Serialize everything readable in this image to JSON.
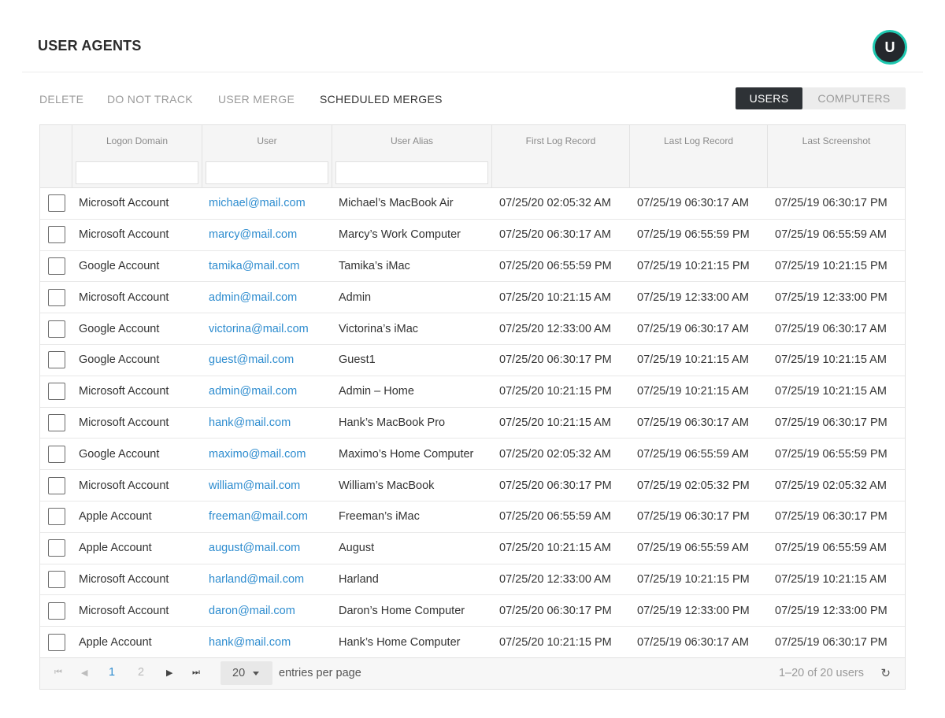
{
  "header": {
    "title": "USER AGENTS",
    "avatar_initial": "U"
  },
  "toolbar": {
    "actions": [
      "DELETE",
      "DO NOT TRACK",
      "USER MERGE",
      "SCHEDULED MERGES"
    ],
    "toggle": {
      "selected": "USERS",
      "other": "COMPUTERS"
    }
  },
  "columns": [
    "Logon Domain",
    "User",
    "User Alias",
    "First Log Record",
    "Last Log Record",
    "Last Screenshot"
  ],
  "filters": {
    "domain": "",
    "user": "",
    "alias": ""
  },
  "rows": [
    {
      "domain": "Microsoft Account",
      "user": "michael@mail.com",
      "alias": "Michael’s MacBook Air",
      "first": "07/25/20 02:05:32 AM",
      "last": "07/25/19 06:30:17 AM",
      "screenshot": "07/25/19 06:30:17 PM"
    },
    {
      "domain": "Microsoft Account",
      "user": "marcy@mail.com",
      "alias": "Marcy’s Work Computer",
      "first": "07/25/20 06:30:17 AM",
      "last": "07/25/19 06:55:59 PM",
      "screenshot": "07/25/19 06:55:59 AM"
    },
    {
      "domain": "Google Account",
      "user": "tamika@mail.com",
      "alias": "Tamika’s iMac",
      "first": "07/25/20 06:55:59 PM",
      "last": "07/25/19 10:21:15 PM",
      "screenshot": "07/25/19 10:21:15 PM"
    },
    {
      "domain": "Microsoft Account",
      "user": "admin@mail.com",
      "alias": "Admin",
      "first": "07/25/20 10:21:15 AM",
      "last": "07/25/19 12:33:00 AM",
      "screenshot": "07/25/19 12:33:00 PM"
    },
    {
      "domain": "Google Account",
      "user": "victorina@mail.com",
      "alias": "Victorina’s iMac",
      "first": "07/25/20 12:33:00 AM",
      "last": "07/25/19 06:30:17 AM",
      "screenshot": "07/25/19 06:30:17 AM"
    },
    {
      "domain": "Google Account",
      "user": "guest@mail.com",
      "alias": "Guest1",
      "first": "07/25/20 06:30:17 PM",
      "last": "07/25/19 10:21:15 AM",
      "screenshot": "07/25/19 10:21:15 AM"
    },
    {
      "domain": "Microsoft Account",
      "user": "admin@mail.com",
      "alias": "Admin – Home",
      "first": "07/25/20 10:21:15 PM",
      "last": "07/25/19 10:21:15 AM",
      "screenshot": "07/25/19 10:21:15 AM"
    },
    {
      "domain": "Microsoft Account",
      "user": "hank@mail.com",
      "alias": "Hank’s MacBook Pro",
      "first": "07/25/20 10:21:15 AM",
      "last": "07/25/19 06:30:17 AM",
      "screenshot": "07/25/19 06:30:17 PM"
    },
    {
      "domain": "Google Account",
      "user": "maximo@mail.com",
      "alias": "Maximo’s Home Computer",
      "first": "07/25/20 02:05:32 AM",
      "last": "07/25/19 06:55:59 AM",
      "screenshot": "07/25/19 06:55:59 PM"
    },
    {
      "domain": "Microsoft Account",
      "user": "william@mail.com",
      "alias": "William’s MacBook",
      "first": "07/25/20 06:30:17 PM",
      "last": "07/25/19 02:05:32 PM",
      "screenshot": "07/25/19 02:05:32 AM"
    },
    {
      "domain": "Apple Account",
      "user": "freeman@mail.com",
      "alias": "Freeman’s iMac",
      "first": "07/25/20 06:55:59 AM",
      "last": "07/25/19 06:30:17 PM",
      "screenshot": "07/25/19 06:30:17 PM"
    },
    {
      "domain": "Apple Account",
      "user": "august@mail.com",
      "alias": "August",
      "first": "07/25/20 10:21:15 AM",
      "last": "07/25/19 06:55:59 AM",
      "screenshot": "07/25/19 06:55:59 AM"
    },
    {
      "domain": "Microsoft Account",
      "user": "harland@mail.com",
      "alias": "Harland",
      "first": "07/25/20 12:33:00 AM",
      "last": "07/25/19 10:21:15 PM",
      "screenshot": "07/25/19 10:21:15 AM"
    },
    {
      "domain": "Microsoft Account",
      "user": "daron@mail.com",
      "alias": "Daron’s Home Computer",
      "first": "07/25/20 06:30:17 PM",
      "last": "07/25/19 12:33:00 PM",
      "screenshot": "07/25/19 12:33:00 PM"
    },
    {
      "domain": "Apple Account",
      "user": "hank@mail.com",
      "alias": "Hank’s Home Computer",
      "first": "07/25/20 10:21:15 PM",
      "last": "07/25/19 06:30:17 AM",
      "screenshot": "07/25/19 06:30:17 PM"
    }
  ],
  "pager": {
    "pages": [
      "1",
      "2"
    ],
    "current_page": "1",
    "per_page": "20",
    "per_page_label": "entries per page",
    "count_text": "1–20 of 20 users",
    "icons": {
      "first": "first-page-icon",
      "prev": "prev-page-icon",
      "next": "next-page-icon",
      "last": "last-page-icon",
      "refresh": "refresh-icon"
    }
  },
  "colors": {
    "link": "#2d8ccf",
    "accent_ring": "#1ec8b0",
    "dark": "#2e3236"
  }
}
